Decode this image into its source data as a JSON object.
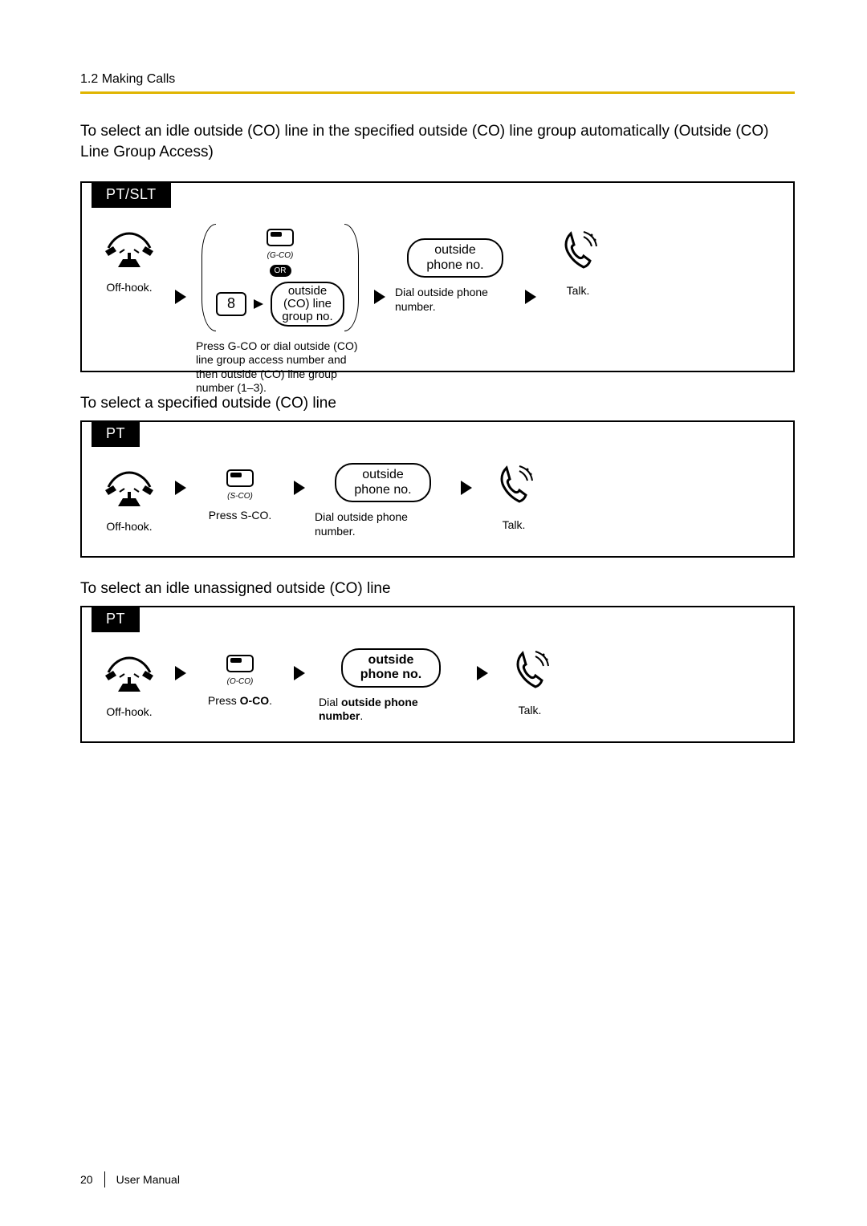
{
  "header": {
    "section": "1.2 Making Calls"
  },
  "intro": "To select an idle outside (CO) line in the specified outside (CO) line group automatically (Outside (CO) Line Group Access)",
  "diagram1": {
    "tab": "PT/SLT",
    "step1_caption": "Off-hook.",
    "gco_label": "(G-CO)",
    "or_label": "OR",
    "digit": "8",
    "alt_bubble": "outside (CO)\nline group no.",
    "step2_caption": "Press G-CO or dial outside (CO) line group access number and then outside (CO) line group number (1–3).",
    "step3_bubble": "outside\nphone no.",
    "step3_caption": "Dial outside phone number.",
    "step4_caption": "Talk."
  },
  "heading2": "To select a specified outside (CO) line",
  "diagram2": {
    "tab": "PT",
    "step1_caption": "Off-hook.",
    "sco_label": "(S-CO)",
    "step2_caption": "Press S-CO.",
    "step3_bubble": "outside\nphone no.",
    "step3_caption": "Dial outside phone number.",
    "step4_caption": "Talk."
  },
  "heading3": "To select an idle unassigned outside (CO) line",
  "diagram3": {
    "tab": "PT",
    "step1_caption": "Off-hook.",
    "oco_label": "(O-CO)",
    "step2_caption_pre": "Press ",
    "step2_caption_bold": "O-CO",
    "step2_caption_post": ".",
    "step3_bubble": "outside\nphone no.",
    "step3_caption_pre": "Dial ",
    "step3_caption_bold": "outside phone number",
    "step3_caption_post": ".",
    "step4_caption": "Talk."
  },
  "footer": {
    "page": "20",
    "title": "User Manual"
  }
}
